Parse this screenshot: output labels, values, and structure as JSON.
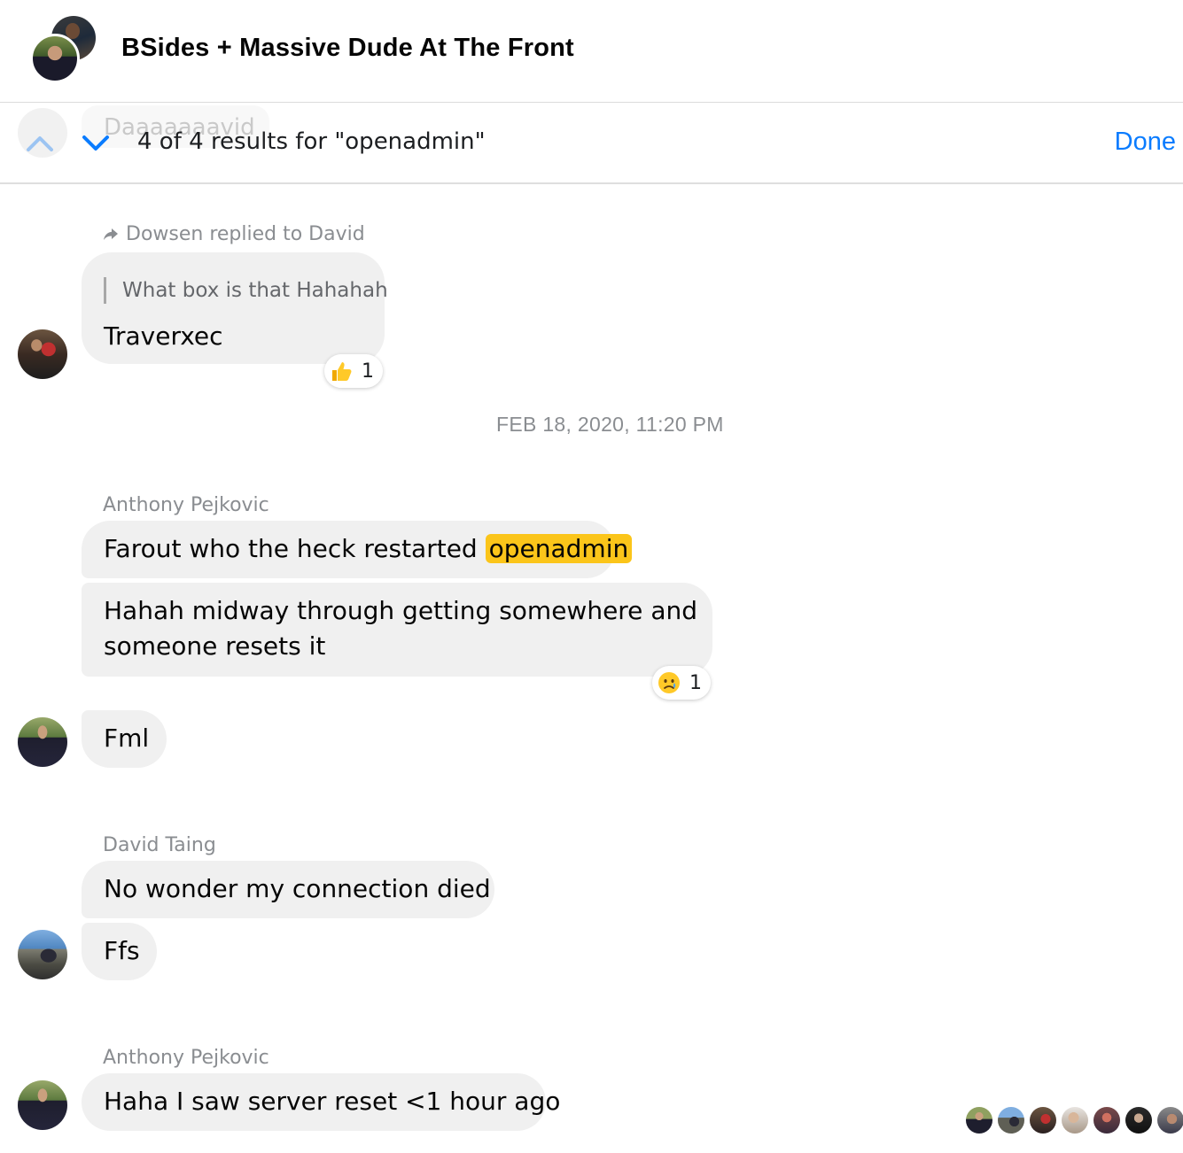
{
  "header": {
    "title": "BSides + Massive Dude At The Front"
  },
  "search": {
    "result_text": "4 of 4 results for \"openadmin\"",
    "done_label": "Done",
    "ghost_text": "Daaaaaaavid"
  },
  "messages": {
    "reply": {
      "meta": "Dowsen replied to David",
      "quote": "What box is that Hahahah",
      "text": "Traverxec",
      "reaction_emoji": "thumbs-up",
      "reaction_count": "1"
    },
    "date_separator": "FEB 18, 2020, 11:20 PM",
    "group1": {
      "sender": "Anthony Pejkovic",
      "msg1_before": "Farout who the heck restarted ",
      "msg1_highlight": "openadmin",
      "msg2_line1": "Hahah midway through getting somewhere and",
      "msg2_line2": "someone resets it",
      "reaction_emoji": "crying-face",
      "reaction_count": "1",
      "msg3": "Fml"
    },
    "group2": {
      "sender": "David Taing",
      "msg1": "No wonder my connection died",
      "msg2": "Ffs"
    },
    "group3": {
      "sender": "Anthony Pejkovic",
      "msg1": "Haha I saw server reset <1 hour ago"
    }
  },
  "read_receipts_count": 7,
  "colors": {
    "accent": "#0a7cff",
    "highlight": "#fbc51a",
    "bubble": "#f0f0f0",
    "meta_text": "#8a8d91"
  }
}
